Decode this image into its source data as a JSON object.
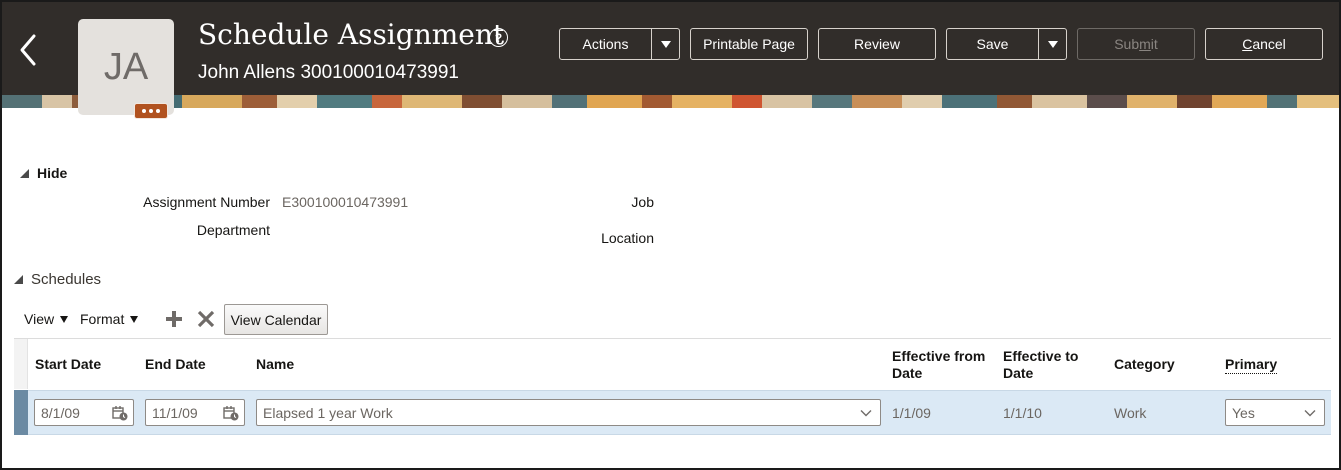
{
  "header": {
    "back_icon": "chevron-left-icon",
    "avatar_initials": "JA",
    "avatar_more_icon": "ellipsis-icon",
    "title": "Schedule Assignment",
    "help_icon": "help-icon",
    "subtitle": "John Allens 300100010473991",
    "buttons": {
      "actions": "Actions",
      "printable": "Printable Page",
      "review": "Review",
      "save": "Save",
      "submit_prefix": "Sub",
      "submit_mnemonic": "m",
      "submit_suffix": "it",
      "cancel_mnemonic": "C",
      "cancel_suffix": "ancel"
    },
    "colors": {
      "background": "#312d2a",
      "avatar_more": "#b1521f"
    }
  },
  "details": {
    "toggle_label": "Hide",
    "assignment_number_label": "Assignment Number",
    "assignment_number_value": "E300100010473991",
    "department_label": "Department",
    "job_label": "Job",
    "location_label": "Location"
  },
  "schedules": {
    "section_label": "Schedules",
    "toolbar": {
      "view": "View",
      "format": "Format",
      "add_icon": "plus-icon",
      "delete_icon": "x-icon",
      "view_calendar": "View Calendar"
    },
    "columns": {
      "start_date": "Start Date",
      "end_date": "End Date",
      "name": "Name",
      "effective_from_line1": "Effective from",
      "effective_from_line2": "Date",
      "effective_to_line1": "Effective to",
      "effective_to_line2": "Date",
      "category": "Category",
      "primary": "Primary"
    },
    "rows": [
      {
        "start_date": "8/1/09",
        "end_date": "11/1/09",
        "name": "Elapsed 1 year Work",
        "effective_from": "1/1/09",
        "effective_to": "1/1/10",
        "category": "Work",
        "primary": "Yes"
      }
    ],
    "colors": {
      "selected_row": "#dbe9f5"
    }
  }
}
